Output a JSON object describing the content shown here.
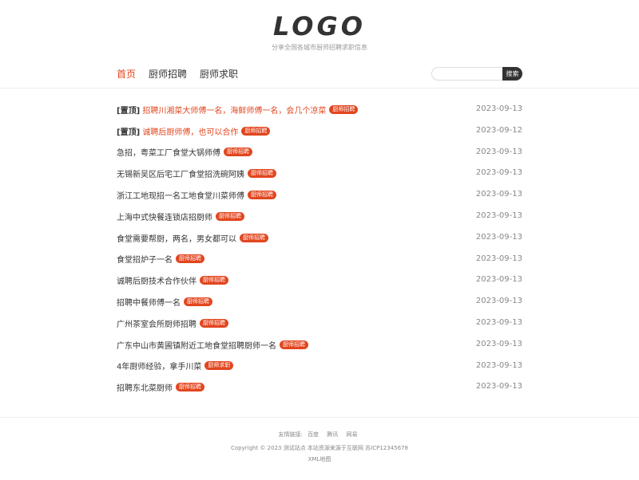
{
  "header": {
    "logo": "LOGO",
    "tagline": "分享全国各城市厨师招聘求职信息"
  },
  "nav": {
    "items": [
      {
        "label": "首页",
        "active": true
      },
      {
        "label": "厨师招聘",
        "active": false
      },
      {
        "label": "厨师求职",
        "active": false
      }
    ]
  },
  "search": {
    "placeholder": "",
    "button_label": "搜索"
  },
  "posts": [
    {
      "prefix": "[置顶]",
      "title": "招聘川湘菜大师傅一名，海鲜师傅一名，会几个凉菜",
      "tag": "厨师招聘",
      "date": "2023-09-13",
      "pinned": true
    },
    {
      "prefix": "[置顶]",
      "title": "诚聘后厨师傅，也可以合作",
      "tag": "厨师招聘",
      "date": "2023-09-12",
      "pinned": true
    },
    {
      "prefix": "",
      "title": "急招，粤菜工厂食堂大锅师傅",
      "tag": "厨师招聘",
      "date": "2023-09-13",
      "pinned": false
    },
    {
      "prefix": "",
      "title": "无锡新吴区后宅工厂食堂招洗碗阿姨",
      "tag": "厨师招聘",
      "date": "2023-09-13",
      "pinned": false
    },
    {
      "prefix": "",
      "title": "浙江工地现招一名工地食堂川菜师傅",
      "tag": "厨师招聘",
      "date": "2023-09-13",
      "pinned": false
    },
    {
      "prefix": "",
      "title": "上海中式快餐连锁店招厨师",
      "tag": "厨师招聘",
      "date": "2023-09-13",
      "pinned": false
    },
    {
      "prefix": "",
      "title": "食堂需要帮厨，两名，男女都可以",
      "tag": "厨师招聘",
      "date": "2023-09-13",
      "pinned": false
    },
    {
      "prefix": "",
      "title": "食堂招炉子一名",
      "tag": "厨师招聘",
      "date": "2023-09-13",
      "pinned": false
    },
    {
      "prefix": "",
      "title": "诚聘后厨技术合作伙伴",
      "tag": "厨师招聘",
      "date": "2023-09-13",
      "pinned": false
    },
    {
      "prefix": "",
      "title": "招聘中餐师傅一名",
      "tag": "厨师招聘",
      "date": "2023-09-13",
      "pinned": false
    },
    {
      "prefix": "",
      "title": "广州茶室会所厨师招聘",
      "tag": "厨师招聘",
      "date": "2023-09-13",
      "pinned": false
    },
    {
      "prefix": "",
      "title": "广东中山市黄圃镇附近工地食堂招聘厨师一名",
      "tag": "厨师招聘",
      "date": "2023-09-13",
      "pinned": false
    },
    {
      "prefix": "",
      "title": "4年厨师经验，拿手川菜",
      "tag": "厨师求职",
      "date": "2023-09-13",
      "pinned": false
    },
    {
      "prefix": "",
      "title": "招聘东北菜厨师",
      "tag": "厨师招聘",
      "date": "2023-09-13",
      "pinned": false
    }
  ],
  "footer": {
    "links_label": "友情链接:",
    "links": [
      "百度",
      "腾讯",
      "网易"
    ],
    "copyright": "Copyright © 2023 测试站点 本站资源来源于互联网 苏ICP12345678",
    "sitemap": "XML地图"
  },
  "colors": {
    "accent": "#e2461f",
    "text": "#333333",
    "muted": "#888888"
  }
}
